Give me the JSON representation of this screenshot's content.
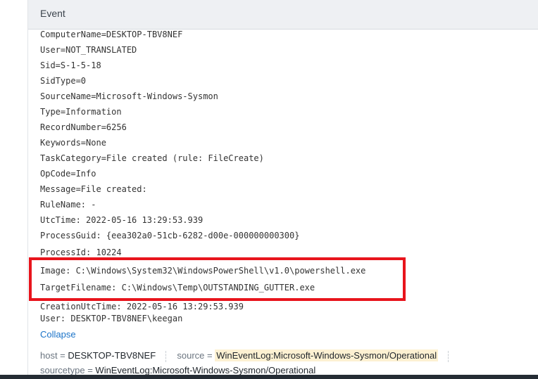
{
  "header": {
    "column_label": "Event"
  },
  "event_lines": [
    "ComputerName=DESKTOP-TBV8NEF",
    "User=NOT_TRANSLATED",
    "Sid=S-1-5-18",
    "SidType=0",
    "SourceName=Microsoft-Windows-Sysmon",
    "Type=Information",
    "RecordNumber=6256",
    "Keywords=None",
    "TaskCategory=File created (rule: FileCreate)",
    "OpCode=Info",
    "Message=File created:",
    "RuleName: -",
    "UtcTime: 2022-05-16 13:29:53.939",
    "ProcessGuid: {eea302a0-51cb-6282-d00e-000000000300}",
    "ProcessId: 10224"
  ],
  "highlighted_lines": [
    "Image: C:\\Windows\\System32\\WindowsPowerShell\\v1.0\\powershell.exe",
    "TargetFilename: C:\\Windows\\Temp\\OUTSTANDING_GUTTER.exe"
  ],
  "after_lines": [
    "CreationUtcTime: 2022-05-16 13:29:53.939",
    "User: DESKTOP-TBV8NEF\\keegan"
  ],
  "collapse_label": "Collapse",
  "fields": {
    "host_key": "host =",
    "host_val": "DESKTOP-TBV8NEF",
    "source_key": "source =",
    "source_val": "WinEventLog:Microsoft-Windows-Sysmon/Operational",
    "sourcetype_key": "sourcetype =",
    "sourcetype_val": "WinEventLog:Microsoft-Windows-Sysmon/Operational"
  },
  "colors": {
    "highlight_border": "#e8141c",
    "link": "#1a73c8",
    "field_highlight": "#fdf1d2"
  }
}
